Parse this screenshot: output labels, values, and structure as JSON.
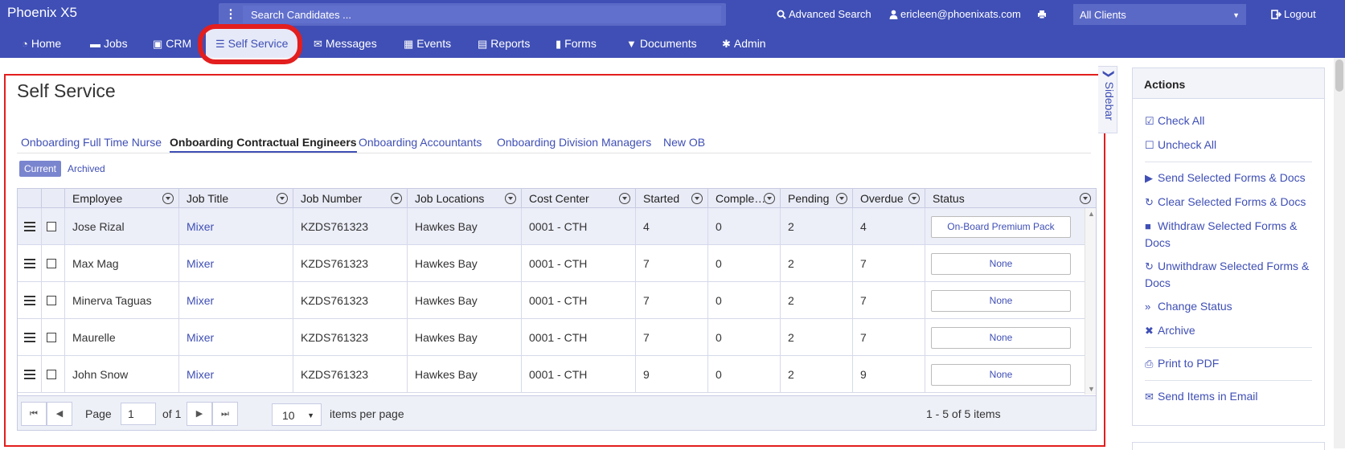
{
  "app": {
    "title": "Phoenix X5"
  },
  "search": {
    "placeholder": "Search Candidates ..."
  },
  "topbar": {
    "advanced_search": "Advanced Search",
    "user": "ericleen@phoenixats.com",
    "client_select": "All Clients",
    "logout": "Logout"
  },
  "nav": {
    "items": [
      {
        "label": "Home",
        "icon": "dashboard-icon"
      },
      {
        "label": "Jobs",
        "icon": "folder-open-icon"
      },
      {
        "label": "CRM",
        "icon": "briefcase-icon"
      },
      {
        "label": "Self Service",
        "icon": "server-icon"
      },
      {
        "label": "Messages",
        "icon": "envelope-icon"
      },
      {
        "label": "Events",
        "icon": "calendar-icon"
      },
      {
        "label": "Reports",
        "icon": "book-icon"
      },
      {
        "label": "Forms",
        "icon": "file-icon"
      },
      {
        "label": "Documents",
        "icon": "filter-icon"
      },
      {
        "label": "Admin",
        "icon": "gear-icon"
      }
    ],
    "active": "Self Service"
  },
  "page": {
    "title": "Self Service"
  },
  "tabs": [
    "Onboarding Full Time Nurse",
    "Onboarding Contractual Engineers",
    "Onboarding Accountants",
    "Onboarding Division Managers",
    "New OB"
  ],
  "active_tab": "Onboarding Contractual Engineers",
  "subtabs": {
    "current": "Current",
    "archived": "Archived"
  },
  "grid": {
    "columns": [
      "Employee",
      "Job Title",
      "Job Number",
      "Job Locations",
      "Cost Center",
      "Started",
      "Comple…",
      "Pending",
      "Overdue",
      "Status"
    ],
    "rows": [
      {
        "employee": "Jose Rizal",
        "job_title": "Mixer",
        "job_number": "KZDS761323",
        "location": "Hawkes Bay",
        "cost_center": "0001 - CTH",
        "started": "4",
        "completed": "0",
        "pending": "2",
        "overdue": "4",
        "status": "On-Board Premium Pack"
      },
      {
        "employee": "Max Mag",
        "job_title": "Mixer",
        "job_number": "KZDS761323",
        "location": "Hawkes Bay",
        "cost_center": "0001 - CTH",
        "started": "7",
        "completed": "0",
        "pending": "2",
        "overdue": "7",
        "status": "None"
      },
      {
        "employee": "Minerva Taguas",
        "job_title": "Mixer",
        "job_number": "KZDS761323",
        "location": "Hawkes Bay",
        "cost_center": "0001 - CTH",
        "started": "7",
        "completed": "0",
        "pending": "2",
        "overdue": "7",
        "status": "None"
      },
      {
        "employee": "Maurelle",
        "job_title": "Mixer",
        "job_number": "KZDS761323",
        "location": "Hawkes Bay",
        "cost_center": "0001 - CTH",
        "started": "7",
        "completed": "0",
        "pending": "2",
        "overdue": "7",
        "status": "None"
      },
      {
        "employee": "John Snow",
        "job_title": "Mixer",
        "job_number": "KZDS761323",
        "location": "Hawkes Bay",
        "cost_center": "0001 - CTH",
        "started": "9",
        "completed": "0",
        "pending": "2",
        "overdue": "9",
        "status": "None"
      }
    ]
  },
  "pager": {
    "page_label": "Page",
    "page_value": "1",
    "of_label": "of 1",
    "page_size": "10",
    "items_per_page": "items per page",
    "summary": "1 - 5 of 5 items"
  },
  "sidebar_toggle": "Sidebar",
  "actions": {
    "title": "Actions",
    "items": [
      {
        "label": "Check All",
        "icon": "check-square-icon"
      },
      {
        "label": "Uncheck All",
        "icon": "square-icon"
      },
      {
        "label": "Send Selected Forms & Docs",
        "icon": "play-icon"
      },
      {
        "label": "Clear Selected Forms & Docs",
        "icon": "refresh-icon"
      },
      {
        "label": "Withdraw Selected Forms & Docs",
        "icon": "stop-icon"
      },
      {
        "label": "Unwithdraw Selected Forms & Docs",
        "icon": "redo-icon"
      },
      {
        "label": "Change Status",
        "icon": "forward-icon"
      },
      {
        "label": "Archive",
        "icon": "times-icon"
      },
      {
        "label": "Print to PDF",
        "icon": "print-icon"
      },
      {
        "label": "Send Items in Email",
        "icon": "envelope-icon"
      }
    ]
  },
  "colors": {
    "brand": "#3f4fb5",
    "highlight": "#e31e1e",
    "selected_row": "#eceef8"
  }
}
